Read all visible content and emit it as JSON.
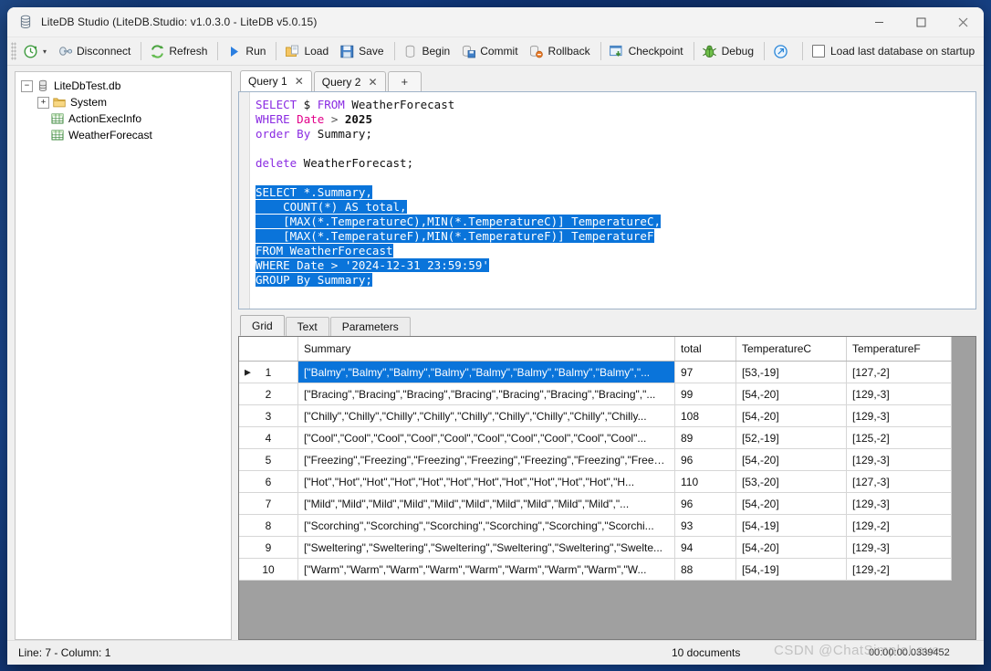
{
  "window": {
    "title": "LiteDB Studio (LiteDB.Studio: v1.0.3.0 - LiteDB v5.0.15)",
    "app_icon": "database-icon",
    "minimize_label": "—",
    "maximize_label": "□",
    "close_label": "✕"
  },
  "toolbar": {
    "connect_label": "",
    "connect_icon": "connect-clock-icon",
    "dropdown_caret": "▾",
    "items": [
      {
        "label": "Disconnect",
        "icon": "disconnect-plug-icon"
      },
      {
        "label": "Refresh",
        "icon": "refresh-arrows-icon"
      },
      {
        "label": "Run",
        "icon": "run-play-icon"
      },
      {
        "label": "Load",
        "icon": "load-folder-icon"
      },
      {
        "label": "Save",
        "icon": "save-disk-icon"
      },
      {
        "label": "Begin",
        "icon": "begin-cylinder-icon"
      },
      {
        "label": "Commit",
        "icon": "commit-disk-icon"
      },
      {
        "label": "Rollback",
        "icon": "rollback-icon"
      },
      {
        "label": "Checkpoint",
        "icon": "checkpoint-download-icon"
      },
      {
        "label": "Debug",
        "icon": "debug-bug-icon"
      }
    ],
    "info_icon": "info-arrow-icon",
    "checkbox_label": "Load last database on startup",
    "checkbox_checked": false
  },
  "sidebar": {
    "root": {
      "label": "LiteDbTest.db",
      "icon": "database-icon",
      "expander": "−"
    },
    "children": [
      {
        "label": "System",
        "icon": "folder-icon",
        "expander": "+"
      },
      {
        "label": "ActionExecInfo",
        "icon": "collection-table-icon",
        "expander": ""
      },
      {
        "label": "WeatherForecast",
        "icon": "collection-table-icon",
        "expander": ""
      }
    ]
  },
  "query_tabs": {
    "tabs": [
      {
        "label": "Query 1",
        "close": "✕",
        "active": true
      },
      {
        "label": "Query 2",
        "close": "✕",
        "active": false
      }
    ],
    "add_label": "+"
  },
  "editor": {
    "lines": [
      [
        {
          "t": "SELECT",
          "c": "kw",
          "s": false
        },
        {
          "t": " $ ",
          "c": "plain",
          "s": false
        },
        {
          "t": "FROM",
          "c": "kw",
          "s": false
        },
        {
          "t": " WeatherForecast",
          "c": "plain",
          "s": false
        }
      ],
      [
        {
          "t": "WHERE",
          "c": "kw",
          "s": false
        },
        {
          "t": " ",
          "c": "plain",
          "s": false
        },
        {
          "t": "Date",
          "c": "fld",
          "s": false
        },
        {
          "t": " ",
          "c": "plain",
          "s": false
        },
        {
          "t": ">",
          "c": "op",
          "s": false
        },
        {
          "t": " ",
          "c": "plain",
          "s": false
        },
        {
          "t": "2025",
          "c": "num",
          "s": false
        }
      ],
      [
        {
          "t": "order",
          "c": "kw",
          "s": false
        },
        {
          "t": " ",
          "c": "plain",
          "s": false
        },
        {
          "t": "By",
          "c": "kw",
          "s": false
        },
        {
          "t": " Summary;",
          "c": "plain",
          "s": false
        }
      ],
      [],
      [
        {
          "t": "delete",
          "c": "kw",
          "s": false
        },
        {
          "t": " WeatherForecast;",
          "c": "plain",
          "s": false
        }
      ],
      [],
      [
        {
          "t": "SELECT *.Summary,",
          "c": "plain",
          "s": true
        }
      ],
      [
        {
          "t": "    COUNT(*) AS total,",
          "c": "plain",
          "s": true
        }
      ],
      [
        {
          "t": "    [MAX(*.TemperatureC),MIN(*.TemperatureC)] TemperatureC,",
          "c": "plain",
          "s": true
        }
      ],
      [
        {
          "t": "    [MAX(*.TemperatureF),MIN(*.TemperatureF)] TemperatureF",
          "c": "plain",
          "s": true
        }
      ],
      [
        {
          "t": "FROM WeatherForecast",
          "c": "plain",
          "s": true
        }
      ],
      [
        {
          "t": "WHERE Date > '2024-12-31 23:59:59'",
          "c": "plain",
          "s": true
        }
      ],
      [
        {
          "t": "GROUP By Summary;",
          "c": "plain",
          "s": true
        }
      ]
    ]
  },
  "result_tabs": [
    {
      "label": "Grid",
      "active": true
    },
    {
      "label": "Text",
      "active": false
    },
    {
      "label": "Parameters",
      "active": false
    }
  ],
  "grid": {
    "columns": [
      "",
      "Summary",
      "total",
      "TemperatureC",
      "TemperatureF"
    ],
    "rows": [
      {
        "n": "1",
        "summary": "[\"Balmy\",\"Balmy\",\"Balmy\",\"Balmy\",\"Balmy\",\"Balmy\",\"Balmy\",\"Balmy\",\"...",
        "total": "97",
        "tc": "[53,-19]",
        "tf": "[127,-2]",
        "selected": true
      },
      {
        "n": "2",
        "summary": "[\"Bracing\",\"Bracing\",\"Bracing\",\"Bracing\",\"Bracing\",\"Bracing\",\"Bracing\",\"...",
        "total": "99",
        "tc": "[54,-20]",
        "tf": "[129,-3]",
        "selected": false
      },
      {
        "n": "3",
        "summary": "[\"Chilly\",\"Chilly\",\"Chilly\",\"Chilly\",\"Chilly\",\"Chilly\",\"Chilly\",\"Chilly\",\"Chilly...",
        "total": "108",
        "tc": "[54,-20]",
        "tf": "[129,-3]",
        "selected": false
      },
      {
        "n": "4",
        "summary": "[\"Cool\",\"Cool\",\"Cool\",\"Cool\",\"Cool\",\"Cool\",\"Cool\",\"Cool\",\"Cool\",\"Cool\"...",
        "total": "89",
        "tc": "[52,-19]",
        "tf": "[125,-2]",
        "selected": false
      },
      {
        "n": "5",
        "summary": "[\"Freezing\",\"Freezing\",\"Freezing\",\"Freezing\",\"Freezing\",\"Freezing\",\"Freezi...",
        "total": "96",
        "tc": "[54,-20]",
        "tf": "[129,-3]",
        "selected": false
      },
      {
        "n": "6",
        "summary": "[\"Hot\",\"Hot\",\"Hot\",\"Hot\",\"Hot\",\"Hot\",\"Hot\",\"Hot\",\"Hot\",\"Hot\",\"Hot\",\"H...",
        "total": "110",
        "tc": "[53,-20]",
        "tf": "[127,-3]",
        "selected": false
      },
      {
        "n": "7",
        "summary": "[\"Mild\",\"Mild\",\"Mild\",\"Mild\",\"Mild\",\"Mild\",\"Mild\",\"Mild\",\"Mild\",\"Mild\",\"...",
        "total": "96",
        "tc": "[54,-20]",
        "tf": "[129,-3]",
        "selected": false
      },
      {
        "n": "8",
        "summary": "[\"Scorching\",\"Scorching\",\"Scorching\",\"Scorching\",\"Scorching\",\"Scorchi...",
        "total": "93",
        "tc": "[54,-19]",
        "tf": "[129,-2]",
        "selected": false
      },
      {
        "n": "9",
        "summary": "[\"Sweltering\",\"Sweltering\",\"Sweltering\",\"Sweltering\",\"Sweltering\",\"Swelte...",
        "total": "94",
        "tc": "[54,-20]",
        "tf": "[129,-3]",
        "selected": false
      },
      {
        "n": "10",
        "summary": "[\"Warm\",\"Warm\",\"Warm\",\"Warm\",\"Warm\",\"Warm\",\"Warm\",\"Warm\",\"W...",
        "total": "88",
        "tc": "[54,-19]",
        "tf": "[129,-2]",
        "selected": false
      }
    ],
    "row_marker": "▶"
  },
  "statusbar": {
    "position": "Line: 7 - Column: 1",
    "documents": "10 documents",
    "elapsed": "00:00:00.0339452"
  },
  "watermark": "CSDN @ChatSimpleLove",
  "colors": {
    "accent": "#0a74da",
    "keyword": "#8a2be2",
    "field": "#e2008a",
    "grid_background": "#a0a0a0"
  }
}
